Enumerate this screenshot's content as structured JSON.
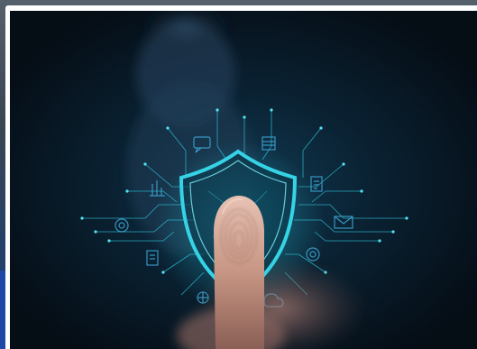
{
  "image": {
    "subject": "fingerprint-shield-icon",
    "accent_color": "#36d3e6",
    "background_color": "#07121c",
    "frame_color": "#ffffff",
    "surrounding_icons": [
      "chat-icon",
      "server-icon",
      "bar-chart-icon",
      "document-icon",
      "gear-icon",
      "envelope-icon",
      "notes-icon",
      "target-icon",
      "network-icon",
      "cloud-icon"
    ]
  }
}
